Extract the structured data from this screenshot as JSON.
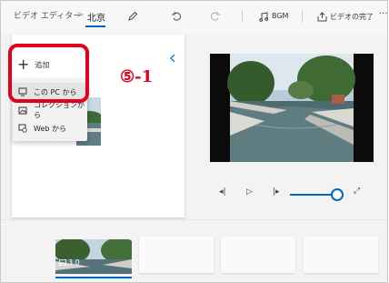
{
  "breadcrumb": {
    "root": "ビデオ エディター",
    "separator": ">",
    "project": "北京"
  },
  "toolbar": {
    "bgm_label": "BGM",
    "finish_label": "ビデオの完了",
    "more": "···"
  },
  "library": {
    "add_label": "追加"
  },
  "add_menu": {
    "items": [
      {
        "label": "この PC から",
        "icon": "pc-icon"
      },
      {
        "label": "コレクションから",
        "icon": "collection-icon"
      },
      {
        "label": "Web から",
        "icon": "web-icon"
      }
    ]
  },
  "annotation": {
    "text": "⑤-1",
    "color": "#e4001b"
  },
  "storyboard": {
    "cards": [
      {
        "duration": "3.0"
      }
    ]
  },
  "colors": {
    "accent": "#0067c0",
    "highlight": "#e4001b"
  },
  "playback": {
    "volume": 1.0
  }
}
